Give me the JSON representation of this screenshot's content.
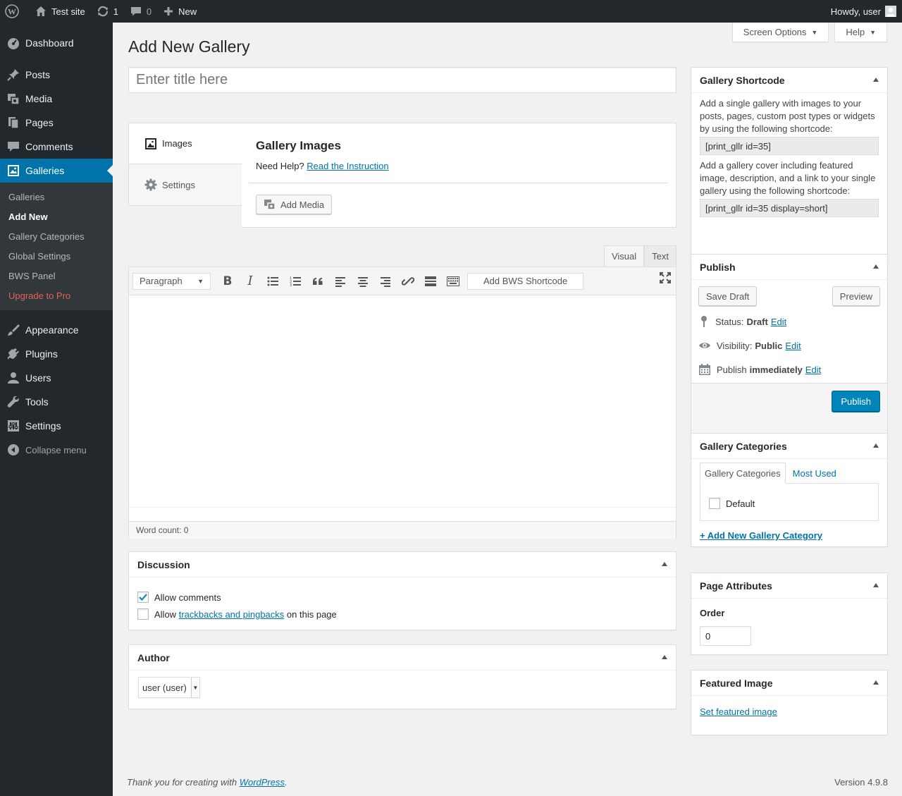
{
  "admin_bar": {
    "site_name": "Test site",
    "updates_count": "1",
    "comments_count": "0",
    "new_label": "New",
    "howdy": "Howdy, user"
  },
  "sidebar": {
    "items_top": [
      {
        "label": "Dashboard",
        "icon": "dashboard-icon"
      }
    ],
    "items_mid": [
      {
        "label": "Posts",
        "icon": "pushpin-icon"
      },
      {
        "label": "Media",
        "icon": "media-icon"
      },
      {
        "label": "Pages",
        "icon": "pages-icon"
      },
      {
        "label": "Comments",
        "icon": "comments-icon"
      },
      {
        "label": "Galleries",
        "icon": "gallery-icon"
      }
    ],
    "submenu": [
      "Galleries",
      "Add New",
      "Gallery Categories",
      "Global Settings",
      "BWS Panel",
      "Upgrade to Pro"
    ],
    "items_bottom": [
      {
        "label": "Appearance",
        "icon": "brush-icon"
      },
      {
        "label": "Plugins",
        "icon": "plugin-icon"
      },
      {
        "label": "Users",
        "icon": "users-icon"
      },
      {
        "label": "Tools",
        "icon": "wrench-icon"
      },
      {
        "label": "Settings",
        "icon": "settings-icon"
      }
    ],
    "collapse_label": "Collapse menu"
  },
  "screen_options": "Screen Options",
  "help": "Help",
  "page_title": "Add New Gallery",
  "title_placeholder": "Enter title here",
  "gallery_box": {
    "tab_images": "Images",
    "tab_settings": "Settings",
    "heading": "Gallery Images",
    "need_help": "Need Help?",
    "instruction_link": "Read the Instruction",
    "add_media": "Add Media"
  },
  "editor": {
    "tab_visual": "Visual",
    "tab_text": "Text",
    "format_select": "Paragraph",
    "bws_shortcode": "Add BWS Shortcode",
    "word_count": "Word count: 0"
  },
  "discussion": {
    "title": "Discussion",
    "allow_comments": "Allow comments",
    "allow_comments_checked": true,
    "allow_trackbacks_prefix": "Allow",
    "trackbacks_link": "trackbacks and pingbacks",
    "allow_trackbacks_suffix": "on this page",
    "allow_trackbacks_checked": false
  },
  "author": {
    "title": "Author",
    "selected": "user (user)"
  },
  "shortcode_box": {
    "title": "Gallery Shortcode",
    "text1": "Add a single gallery with images to your posts, pages, custom post types or widgets by using the following shortcode:",
    "code1": "[print_gllr id=35]",
    "text2": "Add a gallery cover including featured image, description, and a link to your single gallery using the following shortcode:",
    "code2": "[print_gllr id=35 display=short]"
  },
  "publish_box": {
    "title": "Publish",
    "save_draft": "Save Draft",
    "preview": "Preview",
    "status_label": "Status:",
    "status_value": "Draft",
    "visibility_label": "Visibility:",
    "visibility_value": "Public",
    "publish_label": "Publish",
    "publish_value": "immediately",
    "edit": "Edit",
    "publish_button": "Publish"
  },
  "categories_box": {
    "title": "Gallery Categories",
    "tab_all": "Gallery Categories",
    "tab_most_used": "Most Used",
    "default_category": "Default",
    "add_new_link": "+ Add New Gallery Category"
  },
  "page_attributes": {
    "title": "Page Attributes",
    "order_label": "Order",
    "order_value": "0"
  },
  "featured_image": {
    "title": "Featured Image",
    "set_link": "Set featured image"
  },
  "footer": {
    "thanks_prefix": "Thank you for creating with",
    "wordpress_link": "WordPress",
    "thanks_suffix": ".",
    "version": "Version 4.9.8"
  }
}
